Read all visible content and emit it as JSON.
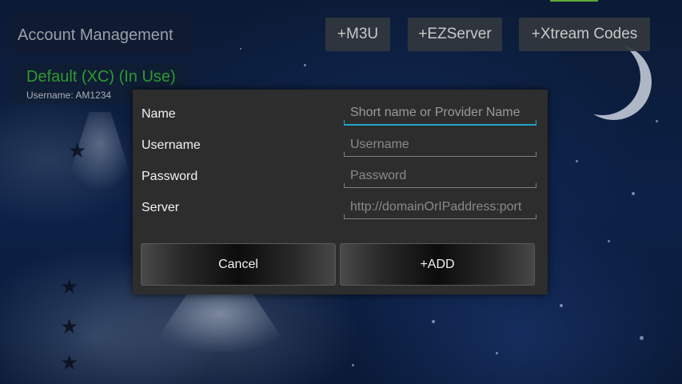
{
  "header": {
    "title": "Account Management",
    "buttons": {
      "m3u": "+M3U",
      "ezserver": "+EZServer",
      "xtream": "+Xtream Codes"
    }
  },
  "account": {
    "name": "Default (XC) (In Use)",
    "username": "Username: AM1234"
  },
  "dialog": {
    "fields": {
      "name": {
        "label": "Name",
        "placeholder": "Short name or Provider Name",
        "value": ""
      },
      "username": {
        "label": "Username",
        "placeholder": "Username",
        "value": ""
      },
      "password": {
        "label": "Password",
        "placeholder": "Password",
        "value": ""
      },
      "server": {
        "label": "Server",
        "placeholder": "http://domainOrIPaddress:port",
        "value": ""
      }
    },
    "cancel_label": "Cancel",
    "add_label": "+ADD"
  },
  "colors": {
    "accent_focus": "#21a3c9",
    "account_active": "#2f9b2f",
    "dialog_bg": "#2e2d2d"
  }
}
